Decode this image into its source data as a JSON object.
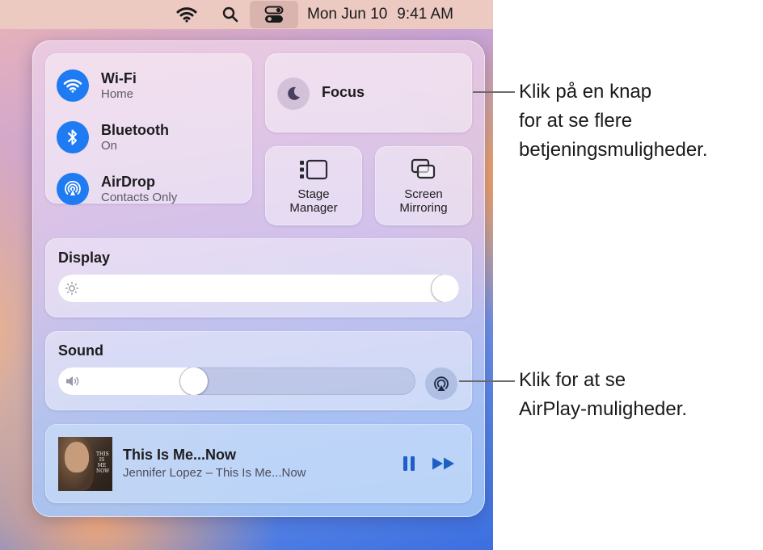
{
  "menubar": {
    "date": "Mon Jun 10",
    "time": "9:41 AM",
    "icons": [
      "wifi-icon",
      "search-icon",
      "control-center-icon"
    ]
  },
  "control_center": {
    "connectivity": [
      {
        "title": "Wi-Fi",
        "subtitle": "Home",
        "icon": "wifi-icon"
      },
      {
        "title": "Bluetooth",
        "subtitle": "On",
        "icon": "bluetooth-icon"
      },
      {
        "title": "AirDrop",
        "subtitle": "Contacts Only",
        "icon": "airdrop-icon"
      }
    ],
    "focus": {
      "label": "Focus",
      "icon": "moon-icon"
    },
    "stage_manager": {
      "line1": "Stage",
      "line2": "Manager"
    },
    "screen_mirroring": {
      "line1": "Screen",
      "line2": "Mirroring"
    },
    "display": {
      "title": "Display",
      "brightness_level": 1.0
    },
    "sound": {
      "title": "Sound",
      "volume_level": 0.37
    },
    "now_playing": {
      "title": "This Is Me...Now",
      "subtitle": "Jennifer Lopez – This Is Me...Now",
      "album_text": "THIS IS ME NOW"
    }
  },
  "callouts": {
    "top": {
      "lines": [
        "Klik på en knap",
        "for at se flere",
        "betjeningsmuligheder."
      ]
    },
    "bottom": {
      "lines": [
        "Klik for at se",
        "AirPlay-muligheder."
      ]
    }
  },
  "colors": {
    "accent_blue": "#1f7bf2",
    "callout_line": "#6b6b6b"
  }
}
